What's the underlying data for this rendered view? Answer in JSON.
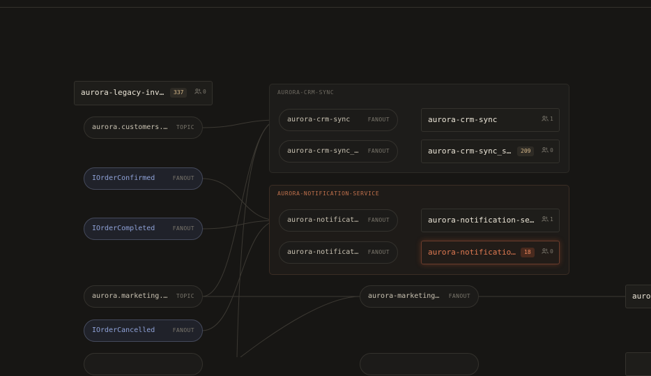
{
  "groups": [
    {
      "id": "crm",
      "title": "AURORA-CRM-SYNC"
    },
    {
      "id": "notif",
      "title": "AURORA-NOTIFICATION-SERVICE"
    }
  ],
  "sources": [
    {
      "id": "s-customers",
      "label": "aurora.customers.…",
      "tag": "TOPIC",
      "kind": "topic"
    },
    {
      "id": "s-confirmed",
      "label": "IOrderConfirmed",
      "tag": "FANOUT",
      "kind": "interface"
    },
    {
      "id": "s-completed",
      "label": "IOrderCompleted",
      "tag": "FANOUT",
      "kind": "interface"
    },
    {
      "id": "s-marketing",
      "label": "aurora.marketing.…",
      "tag": "TOPIC",
      "kind": "topic"
    },
    {
      "id": "s-cancelled",
      "label": "IOrderCancelled",
      "tag": "FANOUT",
      "kind": "interface"
    }
  ],
  "exchanges": [
    {
      "id": "x-crm1",
      "label": "aurora-crm-sync",
      "tag": "FANOUT"
    },
    {
      "id": "x-crm2",
      "label": "aurora-crm-sync_…",
      "tag": "FANOUT"
    },
    {
      "id": "x-notif1",
      "label": "aurora-notificat…",
      "tag": "FANOUT"
    },
    {
      "id": "x-notif2",
      "label": "aurora-notificat…",
      "tag": "FANOUT"
    },
    {
      "id": "x-mkt",
      "label": "aurora-marketing…",
      "tag": "FANOUT"
    }
  ],
  "queues": [
    {
      "id": "q-legacy",
      "label": "aurora-legacy-inv…",
      "messages": "337",
      "consumers": "0",
      "status": "normal"
    },
    {
      "id": "q-crm1",
      "label": "aurora-crm-sync",
      "messages": "",
      "consumers": "1",
      "status": "normal"
    },
    {
      "id": "q-crm2",
      "label": "aurora-crm-sync_s…",
      "messages": "209",
      "consumers": "0",
      "status": "normal"
    },
    {
      "id": "q-notif1",
      "label": "aurora-notification-se…",
      "messages": "",
      "consumers": "1",
      "status": "normal"
    },
    {
      "id": "q-notif2",
      "label": "aurora-notificatio…",
      "messages": "18",
      "consumers": "0",
      "status": "alert"
    },
    {
      "id": "q-right",
      "label": "auro",
      "messages": "",
      "consumers": "",
      "status": "normal"
    }
  ],
  "colors": {
    "background": "#171614",
    "edge": "#3c3933",
    "edge_alert": "#8a4630",
    "interface_text": "#8fa2d8",
    "alert_text": "#e07a52",
    "badge_text": "#d6b889"
  },
  "icons": {
    "consumers": "users-icon"
  }
}
